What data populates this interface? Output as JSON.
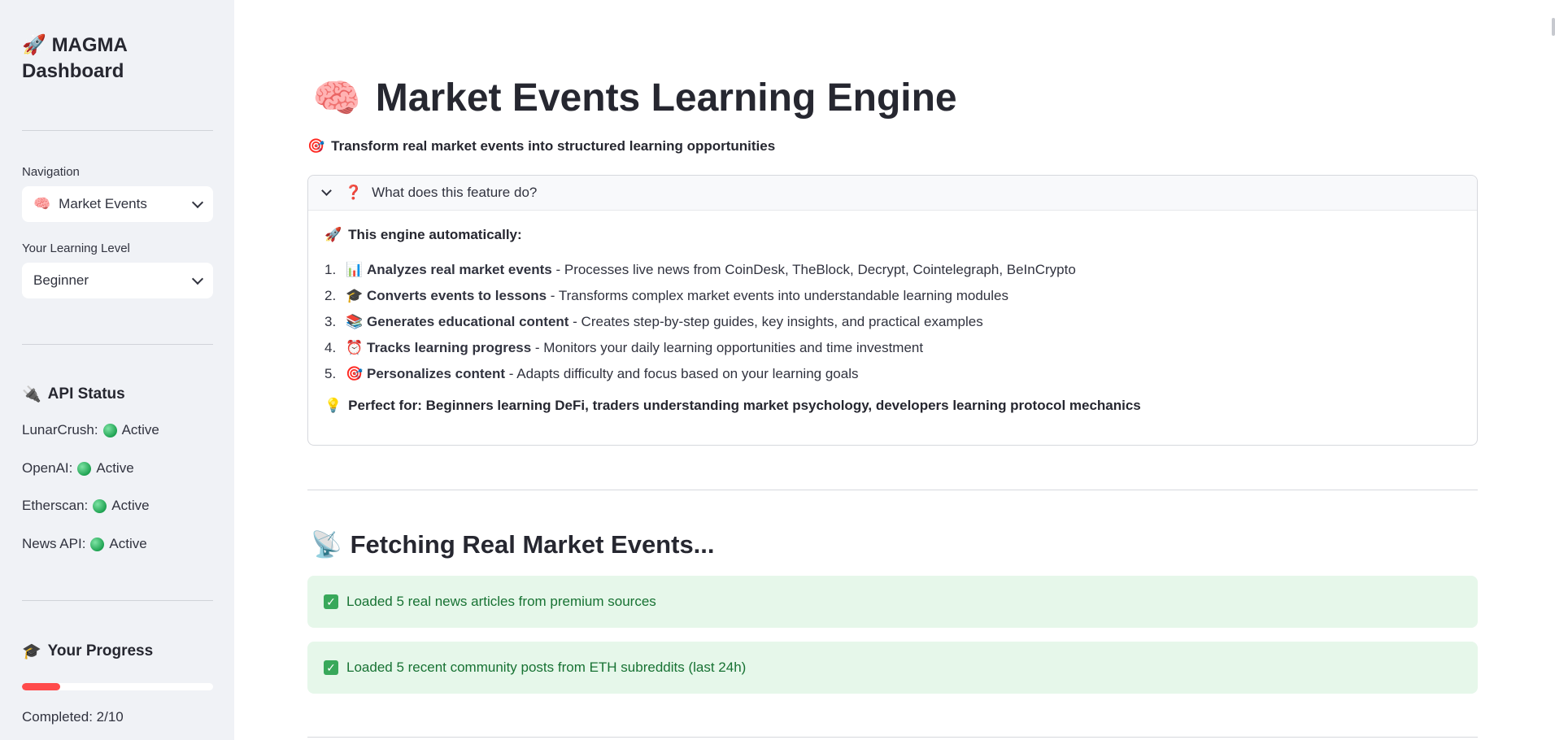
{
  "sidebar": {
    "brand": {
      "icon": "🚀",
      "title": "MAGMA Dashboard"
    },
    "navigation": {
      "label": "Navigation",
      "icon": "🧠",
      "value": "Market Events"
    },
    "learning_level": {
      "label": "Your Learning Level",
      "value": "Beginner"
    },
    "api_status": {
      "icon": "🔌",
      "title": "API Status",
      "items": [
        {
          "name": "LunarCrush:",
          "status": "Active"
        },
        {
          "name": "OpenAI:",
          "status": "Active"
        },
        {
          "name": "Etherscan:",
          "status": "Active"
        },
        {
          "name": "News API:",
          "status": "Active"
        }
      ]
    },
    "progress": {
      "icon": "🎓",
      "title": "Your Progress",
      "fraction": 0.2,
      "completed_text": "Completed: 2/10"
    }
  },
  "main": {
    "title_icon": "🧠",
    "title": "Market Events Learning Engine",
    "subtitle_icon": "🎯",
    "subtitle": "Transform real market events into structured learning opportunities",
    "expander": {
      "icon": "❓",
      "title": "What does this feature do?",
      "intro_icon": "🚀",
      "intro": "This engine automatically:",
      "features": [
        {
          "num": "1.",
          "icon": "📊",
          "bold": "Analyzes real market events",
          "text": " - Processes live news from CoinDesk, TheBlock, Decrypt, Cointelegraph, BeInCrypto"
        },
        {
          "num": "2.",
          "icon": "🎓",
          "bold": "Converts events to lessons",
          "text": " - Transforms complex market events into understandable learning modules"
        },
        {
          "num": "3.",
          "icon": "📚",
          "bold": "Generates educational content",
          "text": " - Creates step-by-step guides, key insights, and practical examples"
        },
        {
          "num": "4.",
          "icon": "⏰",
          "bold": "Tracks learning progress",
          "text": " - Monitors your daily learning opportunities and time investment"
        },
        {
          "num": "5.",
          "icon": "🎯",
          "bold": "Personalizes content",
          "text": " - Adapts difficulty and focus based on your learning goals"
        }
      ],
      "perfect_icon": "💡",
      "perfect": "Perfect for: Beginners learning DeFi, traders understanding market psychology, developers learning protocol mechanics"
    },
    "fetch_icon": "📡",
    "fetch_title": "Fetching Real Market Events...",
    "alerts": [
      "Loaded 5 real news articles from premium sources",
      "Loaded 5 recent community posts from ETH subreddits (last 24h)"
    ],
    "colors": {
      "accent": "#ff4b4b",
      "success_bg": "#e6f7ea",
      "success_text": "#177233",
      "sidebar_bg": "#f0f2f6"
    }
  }
}
